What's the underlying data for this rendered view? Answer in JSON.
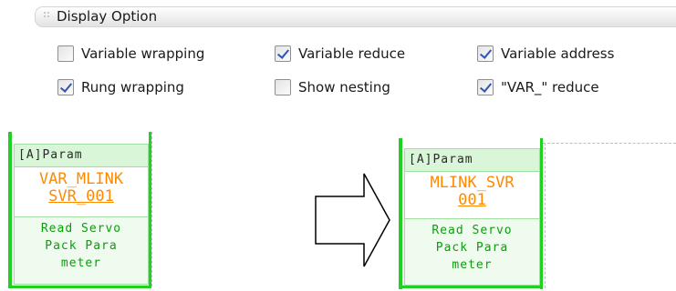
{
  "display_option": {
    "title": "Display Option",
    "options": [
      {
        "label": "Variable wrapping",
        "checked": false
      },
      {
        "label": "Variable reduce",
        "checked": true
      },
      {
        "label": "Variable address",
        "checked": true
      },
      {
        "label": "Rung wrapping",
        "checked": true
      },
      {
        "label": "Show nesting",
        "checked": false
      },
      {
        "label": "\"VAR_\" reduce",
        "checked": true
      }
    ]
  },
  "before": {
    "header": "[A]Param",
    "name_line1": "VAR_MLINK",
    "name_line2": "SVR_001",
    "desc_line1": "Read Servo",
    "desc_line2": "Pack Para",
    "desc_line3": "meter"
  },
  "after": {
    "header": "[A]Param",
    "name_line1": "MLINK_SVR",
    "name_line2": "001",
    "desc_line1": "Read Servo",
    "desc_line2": "Pack Para",
    "desc_line3": "meter"
  }
}
